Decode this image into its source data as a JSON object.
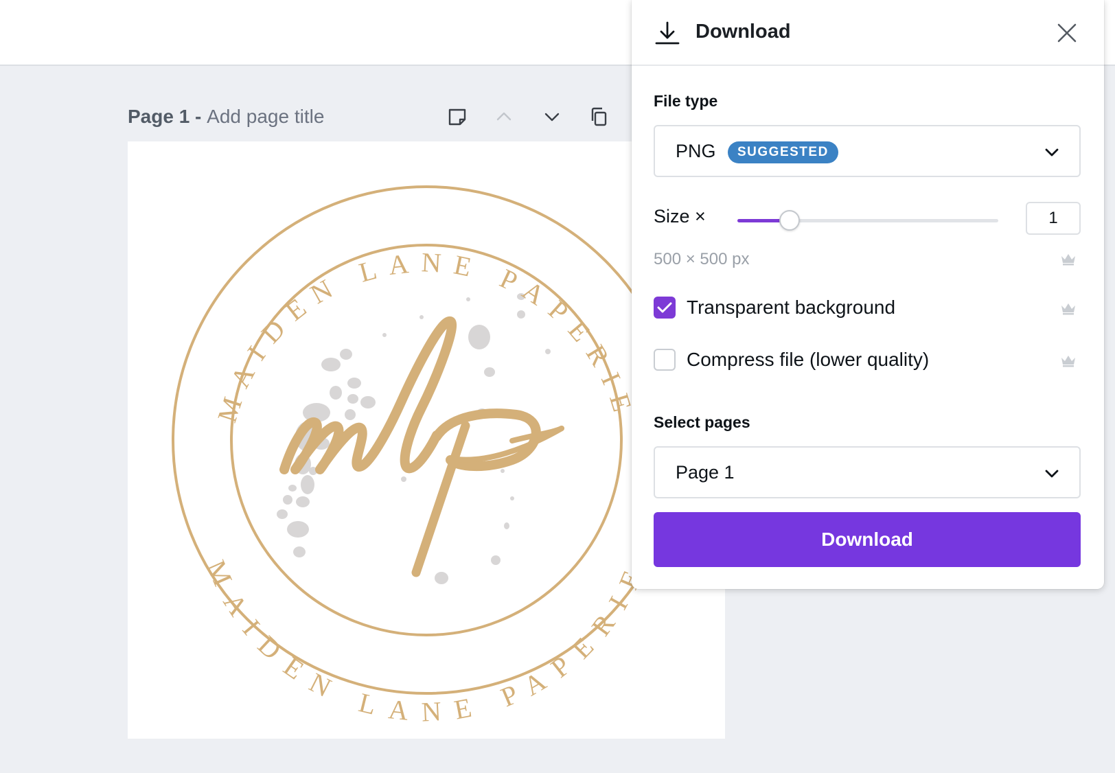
{
  "page": {
    "number_label": "Page 1",
    "separator": " - ",
    "title_placeholder": "Add page title"
  },
  "canvas": {
    "logo": {
      "monogram": "mlp",
      "ring_text_top": "MAIDEN LANE PAPERIE",
      "ring_text_bottom": "MAIDEN LANE PAPERIE",
      "gold_color": "#d4b079",
      "splatter_color": "#d8d6d6"
    }
  },
  "panel": {
    "title": "Download",
    "file_type_label": "File type",
    "file_type_value": "PNG",
    "file_type_badge": "SUGGESTED",
    "size_label": "Size ×",
    "size_value": "1",
    "size_fraction": 0.2,
    "dimensions": "500 × 500 px",
    "transparent_label": "Transparent background",
    "transparent_checked": true,
    "compress_label": "Compress file (lower quality)",
    "compress_checked": false,
    "select_pages_label": "Select pages",
    "select_pages_value": "Page 1",
    "download_button": "Download"
  },
  "colors": {
    "accent": "#7637df",
    "badge": "#3b82c4"
  }
}
